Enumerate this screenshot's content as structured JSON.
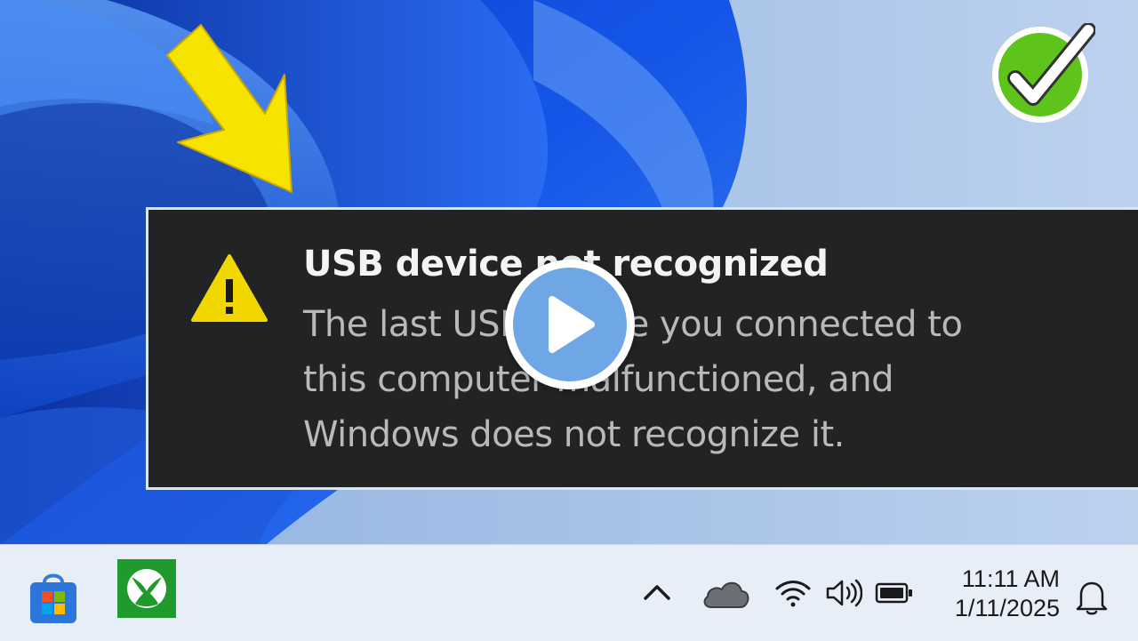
{
  "notification": {
    "title": "USB device not recognized",
    "body_lines": [
      "The last USB device you connected to",
      "this computer malfunctioned, and",
      "Windows does not recognize it."
    ],
    "icon": "warning-triangle-icon"
  },
  "overlay": {
    "play_icon": "play-icon",
    "badge_icon": "green-checkmark-icon",
    "arrow_icon": "yellow-arrow-icon"
  },
  "taskbar": {
    "apps": [
      {
        "name": "Microsoft Store",
        "icon": "store-icon"
      },
      {
        "name": "Xbox",
        "icon": "xbox-icon"
      }
    ],
    "tray": {
      "icons": [
        "chevron-up-icon",
        "onedrive-cloud-icon",
        "wifi-icon",
        "volume-icon",
        "battery-icon",
        "bell-icon"
      ],
      "time": "11:11 AM",
      "date": "1/11/2025"
    }
  },
  "colors": {
    "toast_bg": "#222324",
    "warning_yellow": "#f2d600",
    "check_green": "#5ec41c",
    "play_blue": "#6ea6e6",
    "taskbar_bg": "#e7eef8"
  }
}
